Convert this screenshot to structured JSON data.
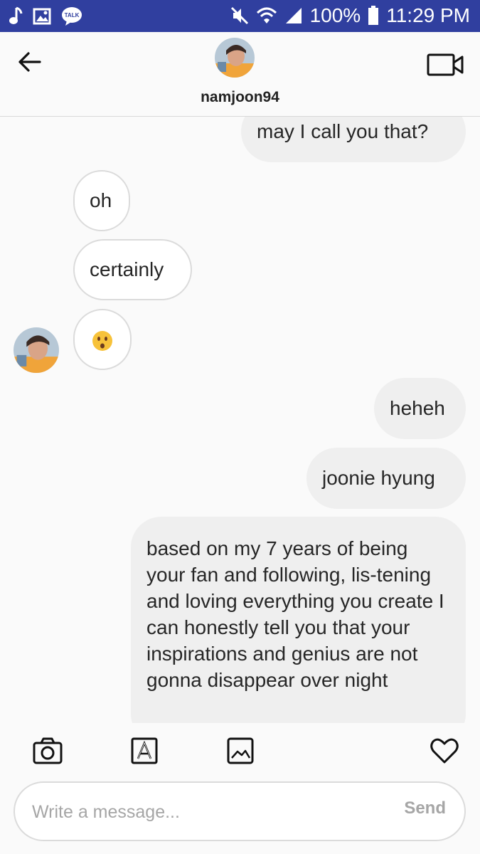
{
  "status_bar": {
    "battery_text": "100%",
    "time": "11:29 PM",
    "left_icons": [
      "music-note-icon",
      "gallery-icon",
      "kakaotalk-icon"
    ],
    "right_icons": [
      "mute-icon",
      "wifi-icon",
      "signal-icon",
      "battery-icon"
    ],
    "talk_badge": "TALK",
    "bg_color": "#303f9f"
  },
  "header": {
    "username": "namjoon94"
  },
  "messages": [
    {
      "side": "sent",
      "text": "may I call you that?"
    },
    {
      "side": "received",
      "text": "oh"
    },
    {
      "side": "received",
      "text": "certainly"
    },
    {
      "side": "received",
      "text": "🙃"
    },
    {
      "side": "sent",
      "text": "heheh"
    },
    {
      "side": "sent",
      "text": "joonie hyung"
    },
    {
      "side": "sent",
      "text": "based on my 7 years of being your fan and following, lis-tening and loving everything you create I can honestly tell you that your inspirations and genius are not gonna disappear over night"
    }
  ],
  "toolbar": {
    "icons": [
      "camera-icon",
      "text-style-icon",
      "gallery-icon",
      "heart-icon"
    ]
  },
  "composer": {
    "placeholder": "Write a message...",
    "send_label": "Send"
  }
}
